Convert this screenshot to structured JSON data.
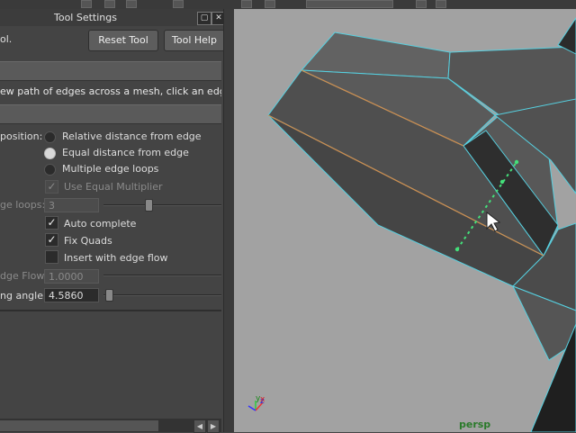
{
  "panel": {
    "title": "Tool Settings",
    "tool_name": "ol.",
    "reset_label": "Reset Tool",
    "help_label": "Tool Help",
    "float_icon": "float-window-icon",
    "close_icon": "close-icon",
    "description": "ew path of edges across a mesh, click an edge and c",
    "position_label": "position:",
    "radio_options": [
      {
        "label": "Relative distance from edge",
        "selected": false
      },
      {
        "label": "Equal distance from edge",
        "selected": true
      },
      {
        "label": "Multiple edge loops",
        "selected": false
      }
    ],
    "use_equal_multiplier": {
      "label": "Use Equal Multiplier",
      "checked": true,
      "enabled": false
    },
    "edge_loops": {
      "label": "ge loops:",
      "value": "3",
      "enabled": false
    },
    "checkboxes": [
      {
        "label": "Auto complete",
        "checked": true
      },
      {
        "label": "Fix Quads",
        "checked": true
      },
      {
        "label": "Insert with edge flow",
        "checked": false
      }
    ],
    "edge_flow": {
      "label": "dge Flow",
      "value": "1.0000",
      "enabled": false
    },
    "snapping_angle": {
      "label": "ng angle:",
      "value": "4.5860"
    }
  },
  "viewport": {
    "camera_label": "persp",
    "axis_labels": {
      "x": "x",
      "y": "y",
      "z": "z"
    },
    "colors": {
      "background": "#a2a2a2",
      "wire": "#56d0e0",
      "selected_edge": "#d08a4a",
      "preview": "#44e07a"
    }
  }
}
